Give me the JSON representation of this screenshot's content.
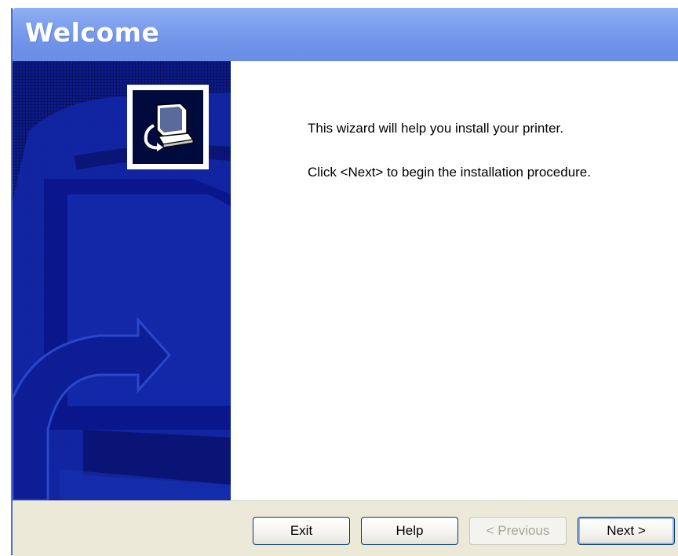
{
  "window": {
    "title": "Welcome"
  },
  "content": {
    "line1": "This wizard will help you install your printer.",
    "line2": "Click <Next> to begin the installation procedure."
  },
  "buttons": {
    "exit": "Exit",
    "help": "Help",
    "previous": "< Previous",
    "previous_enabled": false,
    "next": "Next >"
  },
  "icons": {
    "logo": "computer-install-icon"
  },
  "colors": {
    "title_bar": "#7d9fee",
    "side_panel": "#0c1a8a",
    "button_bar": "#ece9d8"
  }
}
